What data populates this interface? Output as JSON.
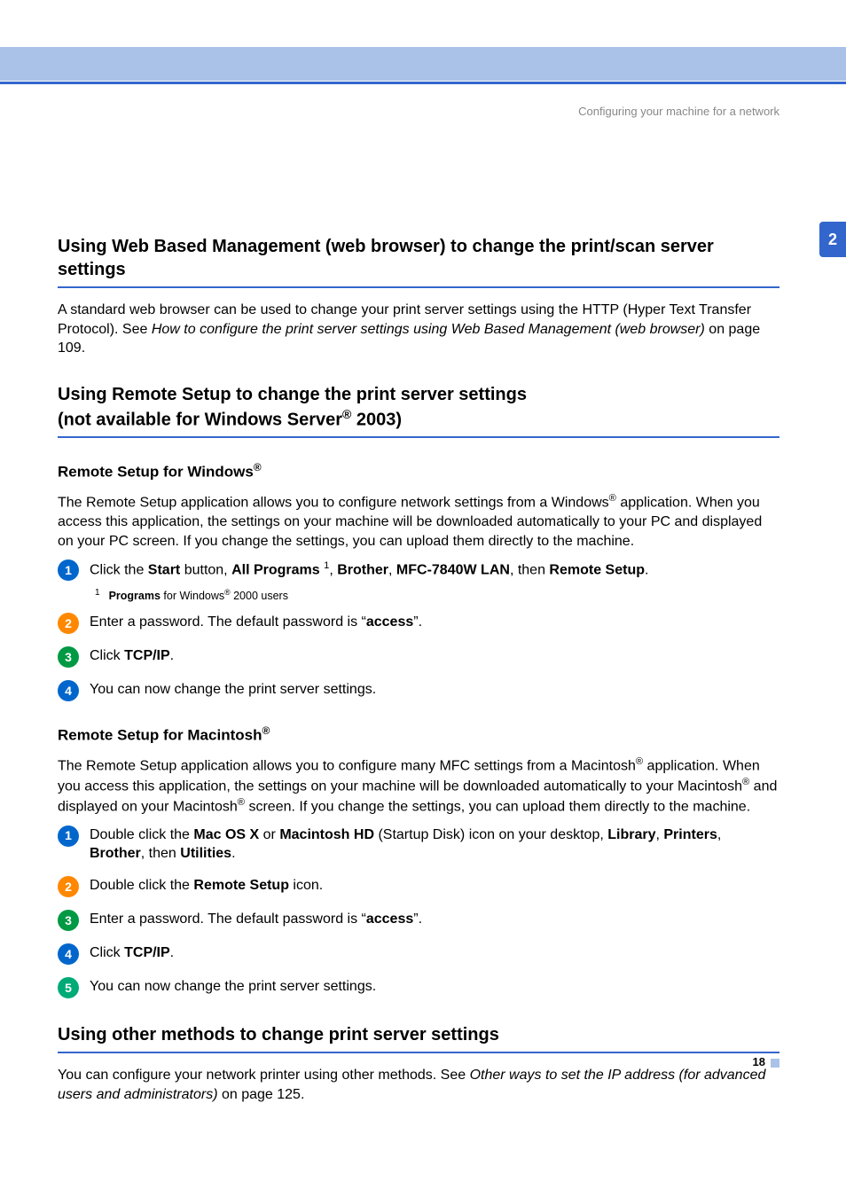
{
  "breadcrumb": "Configuring your machine for a network",
  "side_tab": "2",
  "page_number": "18",
  "sections": {
    "web_mgmt": {
      "title": "Using Web Based Management (web browser) to change the print/scan server settings",
      "p1_a": "A standard web browser can be used to change your print server settings using the HTTP (Hyper Text Transfer Protocol). See ",
      "p1_link": "How to configure the print server settings using Web Based Management (web browser)",
      "p1_b": " on page 109."
    },
    "remote_setup": {
      "title_a": "Using Remote Setup to change the print server settings",
      "title_b": "(not available for Windows Server",
      "title_c": " 2003)",
      "win": {
        "h": "Remote Setup for Windows",
        "p_a": "The Remote Setup application allows you to configure network settings from a Windows",
        "p_b": " application. When you access this application, the settings on your machine will be downloaded automatically to your PC and displayed on your PC screen. If you change the settings, you can upload them directly to the machine.",
        "s1_a": "Click the ",
        "s1_b": "Start",
        "s1_c": " button, ",
        "s1_d": "All Programs",
        "s1_e": ", ",
        "s1_f": "Brother",
        "s1_g": ", ",
        "s1_h": "MFC-7840W LAN",
        "s1_i": ", then ",
        "s1_j": "Remote Setup",
        "s1_k": ".",
        "fn_a": "Programs",
        "fn_b": " for Windows",
        "fn_c": " 2000 users",
        "s2_a": "Enter a password. The default password is “",
        "s2_b": "access",
        "s2_c": "”.",
        "s3_a": "Click ",
        "s3_b": "TCP/IP",
        "s3_c": ".",
        "s4": "You can now change the print server settings."
      },
      "mac": {
        "h": "Remote Setup for Macintosh",
        "p_a": "The Remote Setup application allows you to configure many MFC settings from a Macintosh",
        "p_b": " application. When you access this application, the settings on your machine will be downloaded automatically to your Macintosh",
        "p_c": " and displayed on your Macintosh",
        "p_d": " screen. If you change the settings, you can upload them directly to the machine.",
        "s1_a": "Double click the ",
        "s1_b": "Mac OS X",
        "s1_c": " or ",
        "s1_d": "Macintosh HD",
        "s1_e": " (Startup Disk) icon on your desktop, ",
        "s1_f": "Library",
        "s1_g": ", ",
        "s1_h": "Printers",
        "s1_i": ", ",
        "s1_j": "Brother",
        "s1_k": ", then ",
        "s1_l": "Utilities",
        "s1_m": ".",
        "s2_a": "Double click the ",
        "s2_b": "Remote Setup",
        "s2_c": " icon.",
        "s3_a": "Enter a password. The default password is “",
        "s3_b": "access",
        "s3_c": "”.",
        "s4_a": "Click ",
        "s4_b": "TCP/IP",
        "s4_c": ".",
        "s5": "You can now change the print server settings."
      }
    },
    "other": {
      "title": "Using other methods to change print server settings",
      "p_a": "You can configure your network printer using other methods. See ",
      "p_link": "Other ways to set the IP address (for advanced users and administrators)",
      "p_b": " on page 125."
    }
  }
}
